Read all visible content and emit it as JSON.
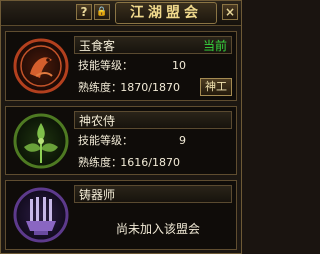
{
  "window": {
    "title": "江湖盟会",
    "help_label": "?",
    "lock_label": "🔒",
    "close_label": "×"
  },
  "guilds": [
    {
      "name": "玉食客",
      "status": "当前",
      "skill_label": "技能等级：",
      "skill_value": "10",
      "proficiency_label": "熟练度：",
      "proficiency_value": "1870/1870",
      "button_label": "神工",
      "emblem_icon": "fish-emblem-icon",
      "emblem_color": "#b3401e"
    },
    {
      "name": "神农侍",
      "skill_label": "技能等级：",
      "skill_value": "9",
      "proficiency_label": "熟练度：",
      "proficiency_value": "1616/1870",
      "emblem_icon": "herb-emblem-icon",
      "emblem_color": "#6aa23a"
    },
    {
      "name": "铸器师",
      "not_joined_text": "尚未加入该盟会",
      "emblem_icon": "forge-emblem-icon",
      "emblem_color": "#7a4fb8"
    }
  ]
}
